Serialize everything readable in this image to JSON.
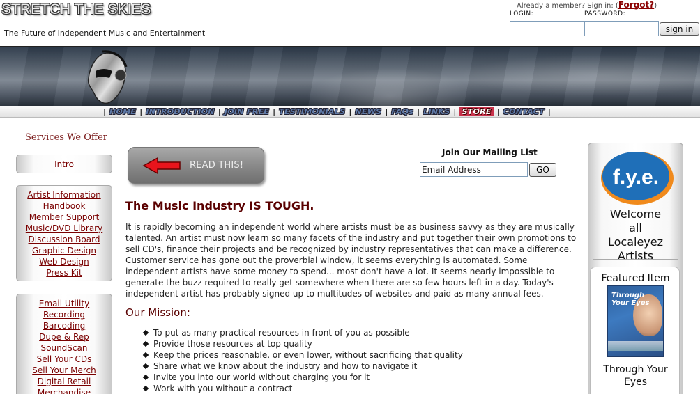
{
  "header": {
    "logo": "STRETCH THE SKIES",
    "tagline": "The Future of Independent Music and Entertainment",
    "member_prompt": "Already a member? Sign in: (",
    "forgot_link": "Forgot?",
    "forgot_close": ")",
    "login_label": "LOGIN:",
    "password_label": "PASSWORD:",
    "signin_button": "sign in"
  },
  "nav": {
    "items": [
      "HOME",
      "INTRODUCTION",
      "JOIN FREE",
      "TESTIMONIALS",
      "NEWS",
      "FAQs",
      "LINKS",
      "STORE",
      "CONTACT"
    ],
    "separator": "|"
  },
  "sidebar": {
    "title": "Services We Offer",
    "intro": "Intro",
    "group1": [
      "Artist Information",
      "Handbook",
      "Member Support",
      "Music/DVD Library",
      "Discussion Board",
      "Graphic Design",
      "Web Design",
      "Press Kit"
    ],
    "group2": [
      "Email Utility",
      "Recording",
      "Barcoding",
      "Dupe & Rep",
      "SoundScan",
      "Sell Your CDs",
      "Sell Your Merch",
      "Digital Retail",
      "Merchandise"
    ]
  },
  "main": {
    "read_button": "READ THIS!",
    "mailing_title": "Join Our Mailing List",
    "mailing_value": "Email Address",
    "mailing_go": "GO",
    "heading": "The Music Industry IS TOUGH.",
    "paragraph": "It is rapidly becoming an independent world where artists must be as business savvy as they are musically talented. An artist must now learn so many facets of the industry and put together their own promotions to sell CD's, finance their projects and be recognized by industry representatives that can make a difference. Customer service has gone out the proverbial window, it seems everything is automated. Some independent artists have some money to spend... most don't have a lot. It seems nearly impossible to generate the buzz required to really get somewhere when there are so few hours left in a day. Today's independent artist has probably signed up to multitudes of websites and paid as many annual fees.",
    "mission_heading": "Our Mission:",
    "mission": [
      "To put as many practical resources in front of you as possible",
      "Provide those resources at top quality",
      "Keep the prices reasonable, or even lower, without sacrificing that quality",
      "Share what we know about the industry and how to navigate it",
      "Invite you into our world without charging you for it",
      "Work with you without a contract"
    ]
  },
  "right": {
    "logo_text": "f.y.e.",
    "welcome": [
      "Welcome",
      "all",
      "Localeyez Artists"
    ],
    "featured_title": "Featured Item",
    "book_title": [
      "Through",
      "Your Eyes"
    ],
    "featured_name": [
      "Through Your",
      "Eyes"
    ]
  },
  "colors": {
    "accent_dark_red": "#5a0000",
    "link_red": "#7a0000",
    "nav_blue": "#5f7aa8",
    "store_red": "#c8324b",
    "fye_blue": "#1f6fb8",
    "fye_orange": "#f08a1c"
  }
}
